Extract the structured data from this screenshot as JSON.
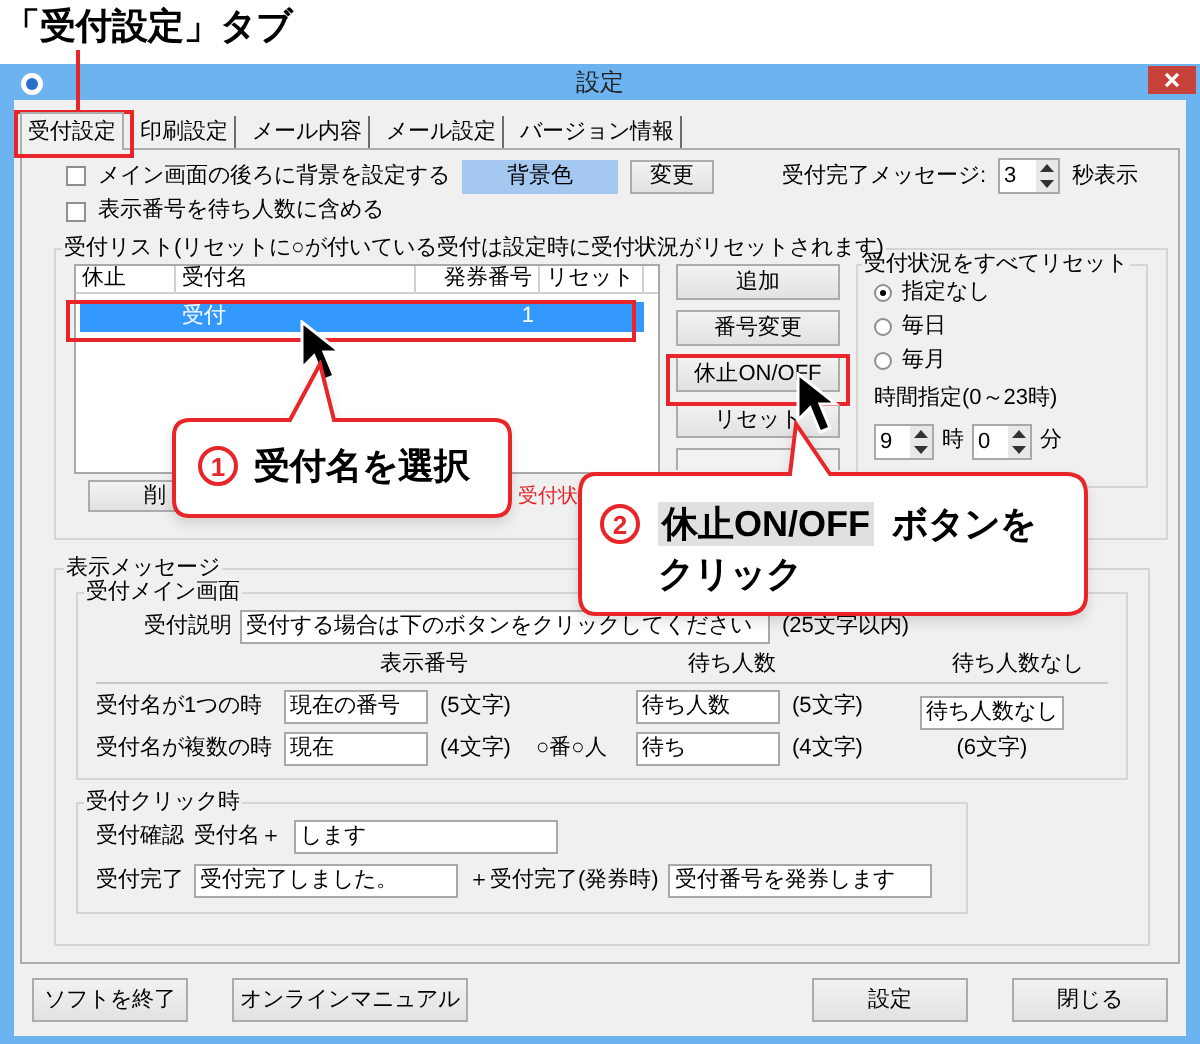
{
  "annotation_title": "「受付設定」タブ",
  "window": {
    "title": "設定"
  },
  "tabs": [
    {
      "label": "受付設定",
      "selected": true
    },
    {
      "label": "印刷設定",
      "selected": false
    },
    {
      "label": "メール内容",
      "selected": false
    },
    {
      "label": "メール設定",
      "selected": false
    },
    {
      "label": "バージョン情報",
      "selected": false
    }
  ],
  "options": [
    {
      "label": "メイン画面の後ろに背景を設定する",
      "checked": false
    },
    {
      "label": "表示番号を待ち人数に含める",
      "checked": false
    }
  ],
  "background": {
    "swatch": "背景色",
    "button": "変更"
  },
  "message_duration": {
    "label": "受付完了メッセージ:",
    "value": "3",
    "unit": "秒表示"
  },
  "reception_list": {
    "title": "受付リスト(リセットに○が付いている受付は設定時に受付状況がリセットされます)",
    "columns": [
      "休止",
      "受付名",
      "発券番号",
      "リセット"
    ],
    "rows": [
      {
        "cells": [
          "",
          "受付",
          "1",
          ""
        ],
        "selected": true
      }
    ],
    "buttons": [
      "追加",
      "番号変更",
      "休止ON/OFF",
      "リセット"
    ],
    "delete_button": "削",
    "note": "受付状"
  },
  "reset_all": {
    "title": "受付状況をすべてリセット",
    "options": [
      {
        "label": "指定なし",
        "selected": true
      },
      {
        "label": "毎日",
        "selected": false
      },
      {
        "label": "毎月",
        "selected": false
      }
    ],
    "time_label": "時間指定(0～23時)",
    "hour": "9",
    "hour_unit": "時",
    "minute": "0",
    "minute_unit": "分"
  },
  "display_message": {
    "title": "表示メッセージ",
    "main_screen": {
      "title": "受付メイン画面",
      "description_label": "受付説明",
      "description_value": "受付する場合は下のボタンをクリックしてください",
      "description_note": "(25文字以内)",
      "headers": [
        "表示番号",
        "待ち人数",
        "待ち人数なし"
      ],
      "rows": [
        {
          "label": "受付名が1つの時",
          "number_value": "現在の番号",
          "number_note": "(5文字)",
          "wait_value": "待ち人数",
          "wait_note": "(5文字)"
        },
        {
          "label": "受付名が複数の時",
          "number_value": "現在",
          "number_note": "(4文字)",
          "joiner": "○番○人",
          "wait_value": "待ち",
          "wait_note": "(4文字)"
        }
      ],
      "no_wait_value": "待ち人数なし",
      "no_wait_note": "(6文字)"
    },
    "on_click": {
      "title": "受付クリック時",
      "confirm_label": "受付確認",
      "confirm_prefix": "受付名＋",
      "confirm_value": "します",
      "done_label": "受付完了",
      "done_value": "受付完了しました。",
      "ticket_label": "＋受付完了(発券時)",
      "ticket_value": "受付番号を発券します"
    }
  },
  "footer_buttons": {
    "left": [
      "ソフトを終了",
      "オンラインマニュアル"
    ],
    "right": [
      "設定",
      "閉じる"
    ]
  },
  "callouts": [
    {
      "number": "1",
      "parts": [
        "受付名を選択"
      ]
    },
    {
      "number": "2",
      "highlight": "休止ON/OFF",
      "parts": [
        "ボタンを",
        "クリック"
      ]
    }
  ]
}
